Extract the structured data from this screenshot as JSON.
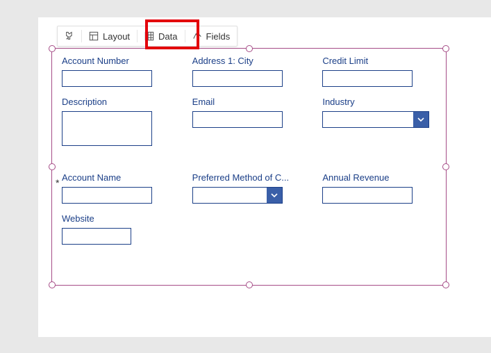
{
  "toolbar": {
    "pin_icon": "pin",
    "layout_label": "Layout",
    "data_label": "Data",
    "fields_label": "Fields"
  },
  "fields": {
    "account_number": {
      "label": "Account Number"
    },
    "address1_city": {
      "label": "Address 1: City"
    },
    "credit_limit": {
      "label": "Credit Limit"
    },
    "description": {
      "label": "Description"
    },
    "email": {
      "label": "Email"
    },
    "industry": {
      "label": "Industry"
    },
    "account_name": {
      "label": "Account Name"
    },
    "preferred_method": {
      "label": "Preferred Method of C..."
    },
    "annual_revenue": {
      "label": "Annual Revenue"
    },
    "website": {
      "label": "Website"
    }
  },
  "required_marker": "*"
}
